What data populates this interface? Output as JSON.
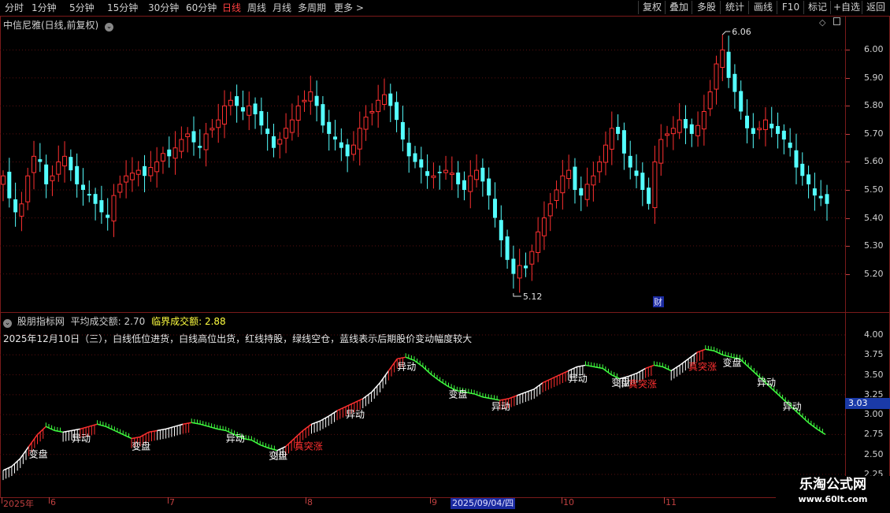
{
  "toolbar": {
    "periods": [
      "分时",
      "1分钟",
      "5分钟",
      "15分钟",
      "30分钟",
      "60分钟",
      "日线",
      "周线",
      "月线",
      "多周期",
      "更多 >"
    ],
    "active_period": "日线",
    "right_buttons": [
      "复权",
      "叠加",
      "多股",
      "统计",
      "画线",
      "F10",
      "标记",
      "+自选",
      "返回"
    ]
  },
  "main": {
    "title": "中信尼雅(日线,前复权)",
    "y_ticks": [
      "6.00",
      "5.90",
      "5.80",
      "5.70",
      "5.60",
      "5.50",
      "5.40",
      "5.30",
      "5.20"
    ],
    "high_label": "6.06",
    "low_label": "5.12",
    "event_badge": "财",
    "colors": {
      "up": "#ff3030",
      "down": "#54ffff",
      "frame": "#7a1a1a",
      "grid": "#5a1010"
    }
  },
  "indicator": {
    "source": "股朋指标网",
    "avg_label": "平均成交额:",
    "avg_value": "2.70",
    "crit_label": "临界成交额:",
    "crit_value": "2.88",
    "note": "2025年12月10日（三），白线低位进货，白线高位出货，红线持股，绿线空仓，蓝线表示后期股价变动幅度较大",
    "y_ticks": [
      "4.00",
      "3.75",
      "3.50",
      "3.25",
      "3.00",
      "2.75",
      "2.50",
      "2.25"
    ],
    "current_value": "3.03",
    "labels": [
      "变盘",
      "异动",
      "真突涨"
    ]
  },
  "x_axis": {
    "ticks": [
      "2025年",
      "6",
      "7",
      "8",
      "9",
      "10",
      "11"
    ],
    "highlight_date": "2025/09/04/四"
  },
  "watermark": {
    "title": "乐淘公式网",
    "url": "www.60lt.com"
  },
  "chart_data": [
    {
      "type": "candlestick",
      "title": "中信尼雅(日线,前复权)",
      "ylim": [
        5.12,
        6.06
      ],
      "y_ticks": [
        5.2,
        5.3,
        5.4,
        5.5,
        5.6,
        5.7,
        5.8,
        5.9,
        6.0
      ],
      "annotations": [
        {
          "label": "6.06",
          "kind": "high"
        },
        {
          "label": "5.12",
          "kind": "low"
        }
      ],
      "x_ticks": [
        "2025年",
        "6",
        "7",
        "8",
        "9",
        "10",
        "11"
      ],
      "closes": [
        5.55,
        5.47,
        5.42,
        5.45,
        5.55,
        5.62,
        5.6,
        5.52,
        5.55,
        5.6,
        5.62,
        5.57,
        5.52,
        5.5,
        5.48,
        5.45,
        5.42,
        5.4,
        5.48,
        5.52,
        5.55,
        5.56,
        5.57,
        5.55,
        5.58,
        5.6,
        5.63,
        5.62,
        5.65,
        5.68,
        5.7,
        5.67,
        5.65,
        5.7,
        5.72,
        5.75,
        5.8,
        5.82,
        5.8,
        5.78,
        5.8,
        5.77,
        5.73,
        5.7,
        5.65,
        5.68,
        5.72,
        5.75,
        5.8,
        5.82,
        5.85,
        5.8,
        5.73,
        5.7,
        5.68,
        5.65,
        5.62,
        5.66,
        5.72,
        5.76,
        5.78,
        5.82,
        5.84,
        5.8,
        5.75,
        5.68,
        5.62,
        5.6,
        5.58,
        5.55,
        5.55,
        5.56,
        5.57,
        5.56,
        5.52,
        5.5,
        5.55,
        5.57,
        5.53,
        5.48,
        5.4,
        5.32,
        5.25,
        5.2,
        5.23,
        5.22,
        5.28,
        5.35,
        5.4,
        5.45,
        5.5,
        5.55,
        5.57,
        5.5,
        5.48,
        5.52,
        5.55,
        5.6,
        5.66,
        5.72,
        5.7,
        5.63,
        5.58,
        5.55,
        5.5,
        5.45,
        5.6,
        5.68,
        5.7,
        5.72,
        5.75,
        5.72,
        5.7,
        5.73,
        5.78,
        5.85,
        5.95,
        6.0,
        5.9,
        5.85,
        5.78,
        5.72,
        5.7,
        5.72,
        5.75,
        5.72,
        5.7,
        5.68,
        5.65,
        5.58,
        5.55,
        5.52,
        5.48,
        5.47,
        5.45
      ]
    },
    {
      "type": "area",
      "title": "平均成交额: 2.70  临界成交额: 2.88",
      "ylim": [
        2.25,
        4.0
      ],
      "y_ticks": [
        2.25,
        2.5,
        2.75,
        3.0,
        3.25,
        3.5,
        3.75,
        4.0
      ],
      "current": 3.03,
      "values": [
        2.3,
        2.35,
        2.45,
        2.6,
        2.75,
        2.85,
        2.8,
        2.78,
        2.8,
        2.82,
        2.85,
        2.88,
        2.85,
        2.8,
        2.75,
        2.7,
        2.72,
        2.78,
        2.8,
        2.82,
        2.85,
        2.88,
        2.9,
        2.88,
        2.85,
        2.82,
        2.8,
        2.75,
        2.7,
        2.68,
        2.62,
        2.58,
        2.55,
        2.6,
        2.7,
        2.8,
        2.88,
        2.92,
        2.98,
        3.05,
        3.1,
        3.15,
        3.2,
        3.28,
        3.4,
        3.55,
        3.7,
        3.72,
        3.68,
        3.6,
        3.5,
        3.42,
        3.35,
        3.3,
        3.28,
        3.26,
        3.22,
        3.2,
        3.18,
        3.2,
        3.24,
        3.28,
        3.32,
        3.4,
        3.45,
        3.5,
        3.55,
        3.6,
        3.62,
        3.6,
        3.58,
        3.5,
        3.45,
        3.48,
        3.52,
        3.58,
        3.62,
        3.6,
        3.55,
        3.62,
        3.7,
        3.78,
        3.82,
        3.8,
        3.75,
        3.72,
        3.7,
        3.6,
        3.5,
        3.4,
        3.3,
        3.2,
        3.1,
        3.0,
        2.9,
        2.82,
        2.75
      ]
    }
  ]
}
